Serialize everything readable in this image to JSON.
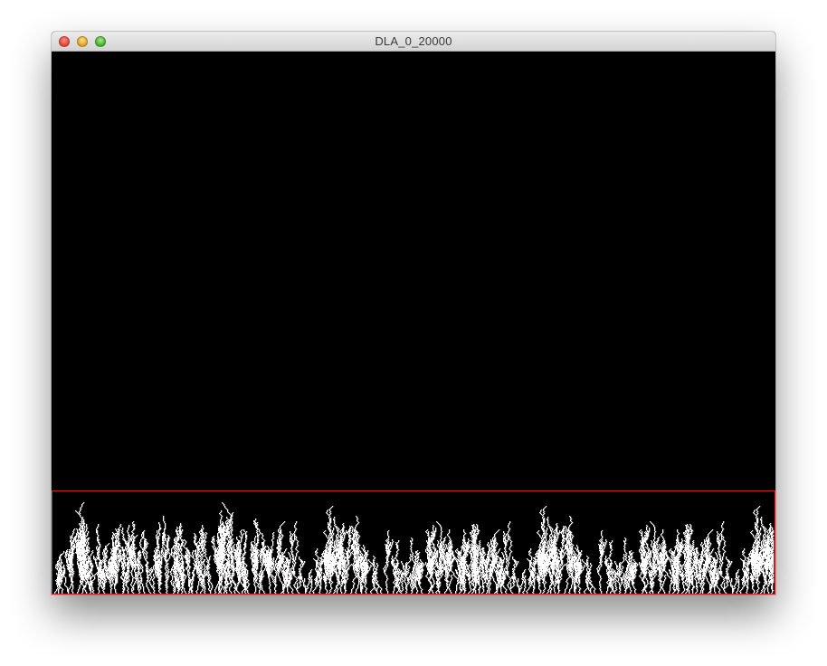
{
  "window": {
    "title": "DLA_0_20000"
  },
  "controls": {
    "close_icon": "close-icon",
    "minimize_icon": "minimize-icon",
    "maximize_icon": "maximize-icon"
  },
  "colors": {
    "background": "#000000",
    "particles": "#ffffff",
    "boundary": "#c62828"
  }
}
